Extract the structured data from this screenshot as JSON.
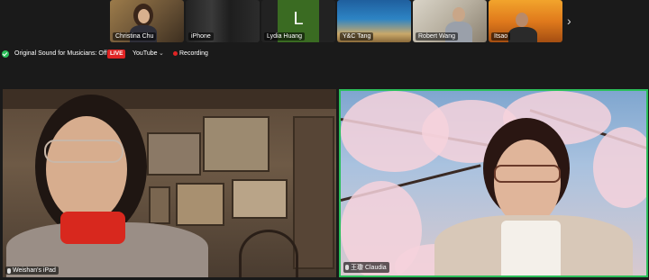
{
  "gallery": {
    "participants": [
      {
        "name": "Christina Chu"
      },
      {
        "name": "iPhone"
      },
      {
        "name": "Lydia Huang",
        "initial": "L"
      },
      {
        "name": "Y&C Tang"
      },
      {
        "name": "Robert Wang"
      },
      {
        "name": "Itsao"
      }
    ],
    "next_icon": "chevron-right-icon"
  },
  "toolbar": {
    "original_sound": "Original Sound for Musicians: Off",
    "live_badge": "LIVE",
    "streaming_target": "YouTube",
    "recording_label": "Recording",
    "colors": {
      "live": "#e02424",
      "secure": "#2bbf5a",
      "active_speaker": "#2bbf5a"
    }
  },
  "videos": {
    "left_name": "Weishan's iPad",
    "right_name": "王瓊 Claudia"
  }
}
